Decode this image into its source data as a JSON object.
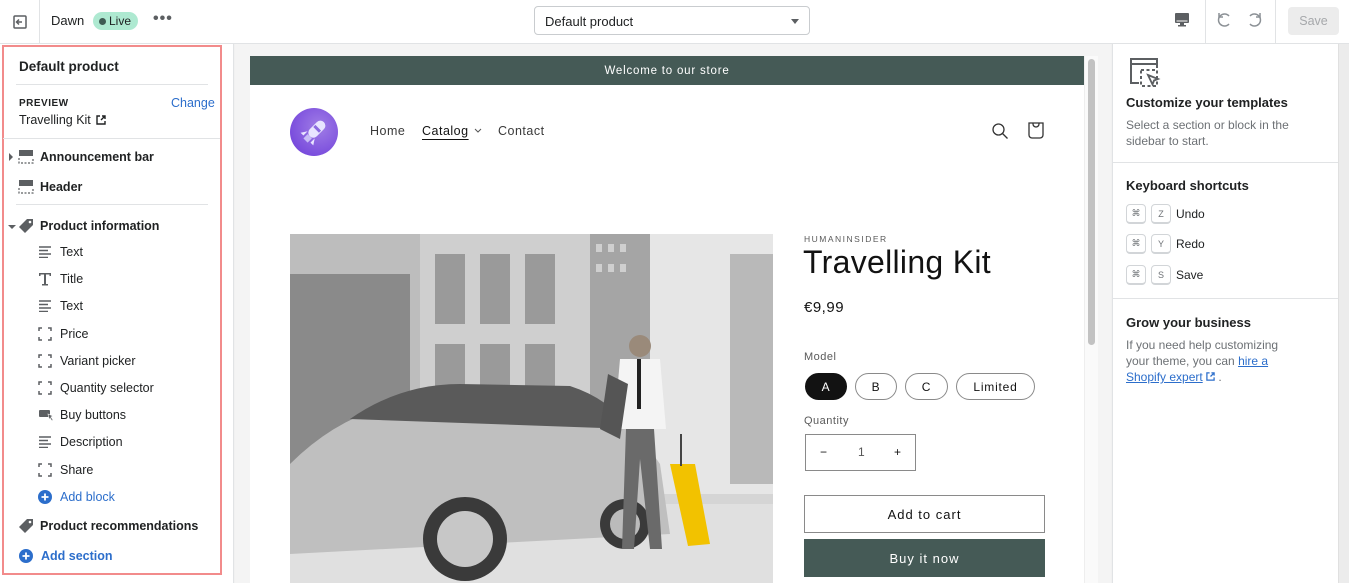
{
  "topbar": {
    "theme_name": "Dawn",
    "live_badge": "Live",
    "more_label": "•••",
    "template_select": "Default product",
    "save_label": "Save"
  },
  "sidebar": {
    "title": "Default product",
    "preview_label": "PREVIEW",
    "change_label": "Change",
    "preview_product": "Travelling Kit",
    "sections": [
      {
        "label": "Announcement bar",
        "icon": "section-icon",
        "expandable": true,
        "expanded": false
      },
      {
        "label": "Header",
        "icon": "section-icon",
        "expandable": false
      }
    ],
    "product_info": {
      "label": "Product information",
      "icon": "tag-icon",
      "expanded": true,
      "blocks": [
        {
          "label": "Text",
          "icon": "text-lines-icon"
        },
        {
          "label": "Title",
          "icon": "title-t-icon"
        },
        {
          "label": "Text",
          "icon": "text-lines-icon"
        },
        {
          "label": "Price",
          "icon": "block-frame-icon"
        },
        {
          "label": "Variant picker",
          "icon": "block-frame-icon"
        },
        {
          "label": "Quantity selector",
          "icon": "block-frame-icon"
        },
        {
          "label": "Buy buttons",
          "icon": "buy-buttons-icon"
        },
        {
          "label": "Description",
          "icon": "text-lines-icon"
        },
        {
          "label": "Share",
          "icon": "block-frame-icon"
        }
      ],
      "add_block_label": "Add block"
    },
    "product_recommendations": {
      "label": "Product recommendations",
      "icon": "tag-icon"
    },
    "add_section_label": "Add section"
  },
  "store": {
    "announcement": "Welcome to our store",
    "nav": [
      {
        "label": "Home",
        "active": false
      },
      {
        "label": "Catalog",
        "active": true,
        "has_dropdown": true
      },
      {
        "label": "Contact",
        "active": false
      }
    ],
    "product": {
      "vendor": "HUMANINSIDER",
      "title": "Travelling Kit",
      "price": "€9,99",
      "option_label": "Model",
      "options": [
        {
          "label": "A",
          "selected": true
        },
        {
          "label": "B",
          "selected": false
        },
        {
          "label": "C",
          "selected": false
        },
        {
          "label": "Limited",
          "selected": false
        }
      ],
      "quantity_label": "Quantity",
      "quantity": "1",
      "minus": "−",
      "plus": "+",
      "add_to_cart": "Add to cart",
      "buy_now": "Buy it now"
    }
  },
  "right_panel": {
    "customize_title": "Customize your templates",
    "customize_text": "Select a section or block in the sidebar to start.",
    "shortcuts_title": "Keyboard shortcuts",
    "shortcuts": [
      {
        "mod": "⌘",
        "key": "Z",
        "action": "Undo"
      },
      {
        "mod": "⌘",
        "key": "Y",
        "action": "Redo"
      },
      {
        "mod": "⌘",
        "key": "S",
        "action": "Save"
      }
    ],
    "grow_title": "Grow your business",
    "grow_text_before": "If you need help customizing your theme, you can ",
    "grow_link": "hire a Shopify expert",
    "grow_text_after": " ."
  },
  "colors": {
    "accent": "#2c6ecb",
    "brand_dark": "#455a56",
    "live_badge": "#aee9d1",
    "selection_outline": "#f28b8b"
  }
}
